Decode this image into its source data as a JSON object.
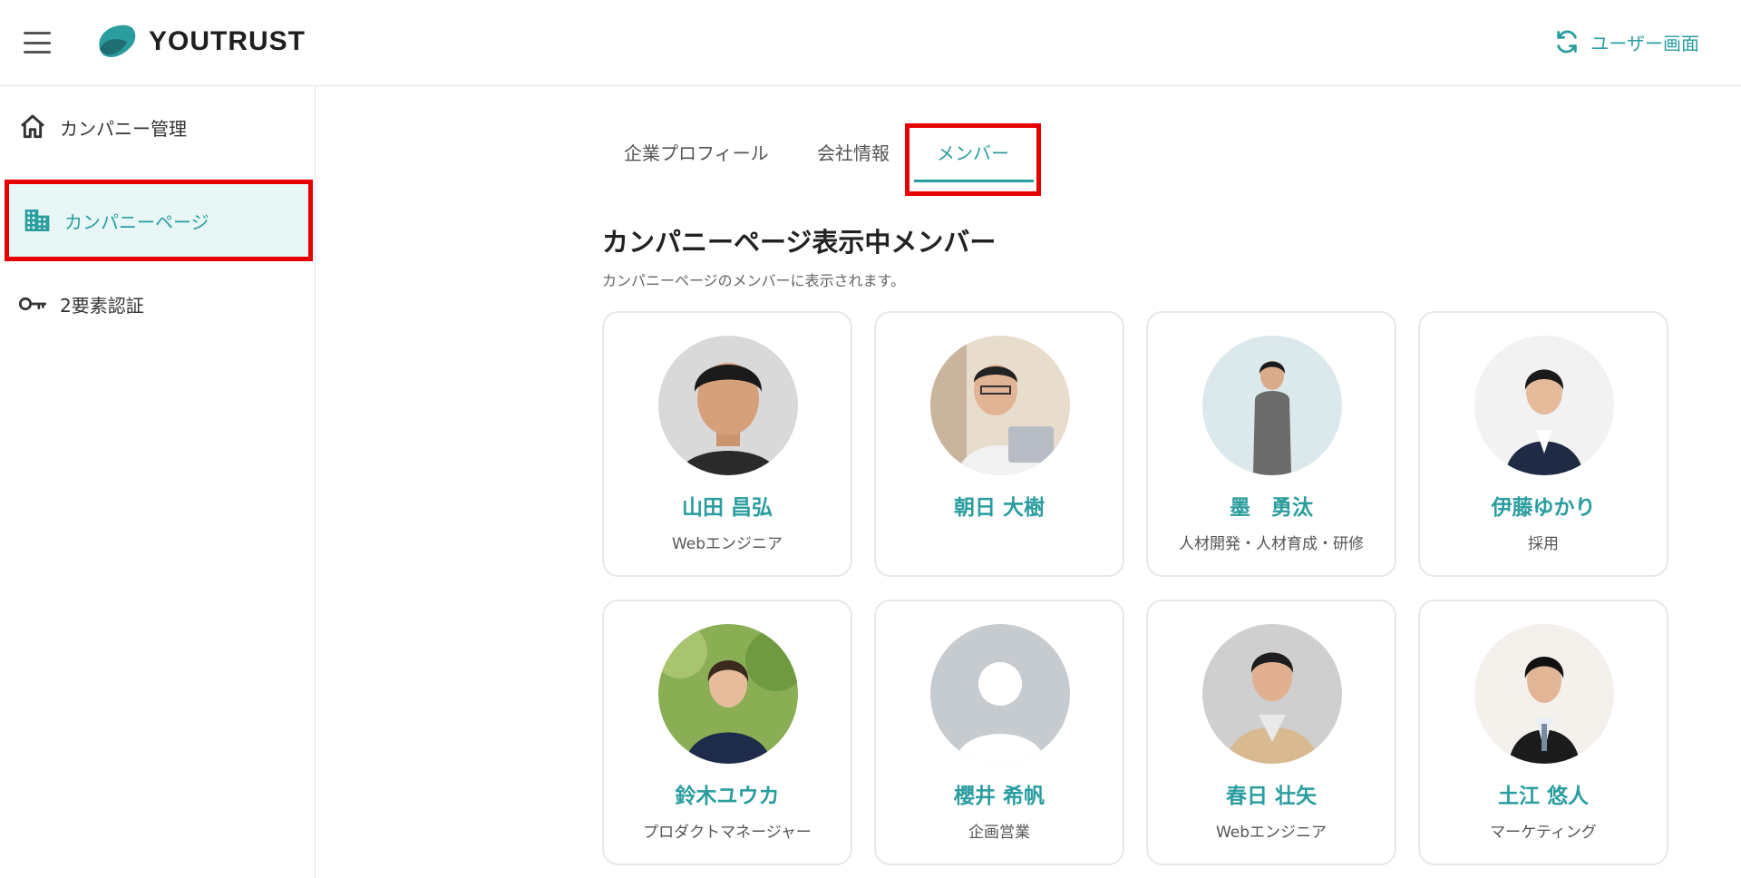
{
  "header": {
    "logo_text": "YOUTRUST",
    "switch_label": "ユーザー画面",
    "accent": "#2a9d9f"
  },
  "sidebar": {
    "items": [
      {
        "label": "カンパニー管理",
        "icon": "home-icon"
      },
      {
        "label": "カンパニーページ",
        "icon": "building-icon",
        "active": true
      },
      {
        "label": "2要素認証",
        "icon": "key-icon"
      }
    ]
  },
  "tabs": [
    {
      "label": "企業プロフィール"
    },
    {
      "label": "会社情報"
    },
    {
      "label": "メンバー",
      "active": true
    }
  ],
  "section": {
    "title": "カンパニーページ表示中メンバー",
    "subtitle": "カンパニーページのメンバーに表示されます。"
  },
  "members": [
    {
      "name": "山田 昌弘",
      "role": "Webエンジニア"
    },
    {
      "name": "朝日 大樹",
      "role": ""
    },
    {
      "name": "墨　勇汰",
      "role": "人材開発・人材育成・研修"
    },
    {
      "name": "伊藤ゆかり",
      "role": "採用"
    },
    {
      "name": "鈴木ユウカ",
      "role": "プロダクトマネージャー"
    },
    {
      "name": "櫻井 希帆",
      "role": "企画営業"
    },
    {
      "name": "春日 壮矢",
      "role": "Webエンジニア"
    },
    {
      "name": "土江 悠人",
      "role": "マーケティング"
    }
  ],
  "colors": {
    "accent": "#2a9d9f",
    "active_bg": "#e8f6f6",
    "highlight": "#e60000"
  }
}
